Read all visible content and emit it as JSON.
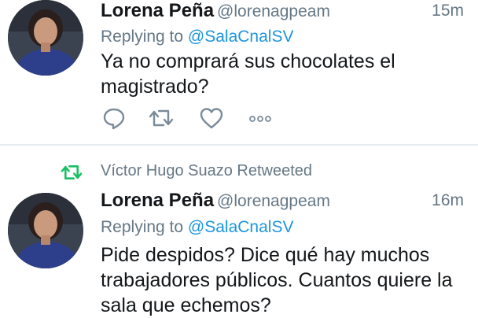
{
  "tweets": [
    {
      "author_name": "Lorena Peña",
      "author_handle": "@lorenagpeam",
      "time": "15m",
      "replying_prefix": "Replying to",
      "replying_to": "@SalaCnalSV",
      "text": "Ya no comprará sus chocolates el magistrado?",
      "actions": [
        "reply-icon",
        "retweet-icon",
        "like-icon",
        "more-icon"
      ]
    },
    {
      "retweet_context": "Víctor Hugo Suazo Retweeted",
      "author_name": "Lorena Peña",
      "author_handle": "@lorenagpeam",
      "time": "16m",
      "replying_prefix": "Replying to",
      "replying_to": "@SalaCnalSV",
      "text": "Pide despidos? Dice qué hay muchos trabajadores públicos. Cuantos quiere la sala que echemos?"
    }
  ],
  "colors": {
    "name": "#14171a",
    "meta": "#657786",
    "link": "#1b95e0",
    "retweet_green": "#17bf63",
    "divider": "#e6ecf0"
  }
}
